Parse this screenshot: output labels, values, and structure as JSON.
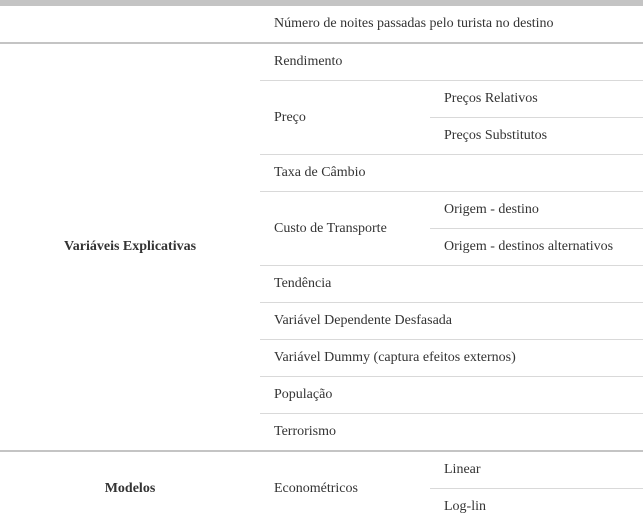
{
  "dependente": {
    "value": "Número de noites passadas pelo turista no destino"
  },
  "explicativas": {
    "label": "Variáveis Explicativas",
    "items": {
      "rendimento": "Rendimento",
      "preco": {
        "label": "Preço",
        "subitems": {
          "relativos": "Preços Relativos",
          "substitutos": "Preços Substitutos"
        }
      },
      "cambio": "Taxa de Câmbio",
      "transporte": {
        "label": "Custo de Transporte",
        "subitems": {
          "origem_destino": "Origem - destino",
          "origem_alternativos": "Origem - destinos alternativos"
        }
      },
      "tendencia": "Tendência",
      "desfasada": "Variável Dependente Desfasada",
      "dummy": "Variável Dummy (captura efeitos externos)",
      "populacao": "População",
      "terrorismo": "Terrorismo"
    }
  },
  "modelos": {
    "label": "Modelos",
    "econometricos": {
      "label": "Econométricos",
      "subitems": {
        "linear": "Linear",
        "loglin": "Log-lin"
      }
    }
  }
}
